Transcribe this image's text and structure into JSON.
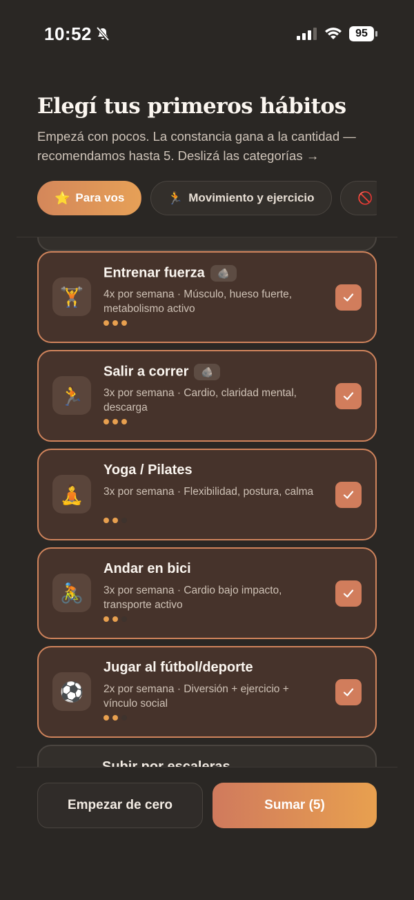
{
  "status_bar": {
    "time": "10:52",
    "battery": "95"
  },
  "header": {
    "title": "Elegí tus primeros hábitos",
    "subtitle": "Empezá con pocos. La constancia gana a la cantidad — recomendamos hasta 5. Deslizá las categorías →"
  },
  "tabs": [
    {
      "emoji": "⭐",
      "label": "Para vos",
      "active": true
    },
    {
      "emoji": "🏃",
      "label": "Movimiento y ejercicio",
      "active": false
    },
    {
      "emoji": "🚫",
      "label": "",
      "active": false
    }
  ],
  "habits": [
    {
      "emoji": "🏋️",
      "name": "Entrenar fuerza",
      "badge": "🪨",
      "description": "4x por semana · Músculo, hueso fuerte, metabolismo activo",
      "level": 3,
      "selected": true
    },
    {
      "emoji": "🏃",
      "name": "Salir a correr",
      "badge": "🪨",
      "description": "3x por semana · Cardio, claridad mental, descarga",
      "level": 3,
      "selected": true
    },
    {
      "emoji": "🧘",
      "name": "Yoga / Pilates",
      "badge": "",
      "description": "3x por semana · Flexibilidad, postura, calma",
      "level": 2,
      "selected": true
    },
    {
      "emoji": "🚴",
      "name": "Andar en bici",
      "badge": "",
      "description": "3x por semana · Cardio bajo impacto, transporte activo",
      "level": 2,
      "selected": true
    },
    {
      "emoji": "⚽",
      "name": "Jugar al fútbol/deporte",
      "badge": "",
      "description": "2x por semana · Diversión + ejercicio + vínculo social",
      "level": 2,
      "selected": true
    }
  ],
  "next_habit_peek": "Subir por escaleras",
  "actions": {
    "start_empty": "Empezar de cero",
    "add": "Sumar (5)"
  }
}
